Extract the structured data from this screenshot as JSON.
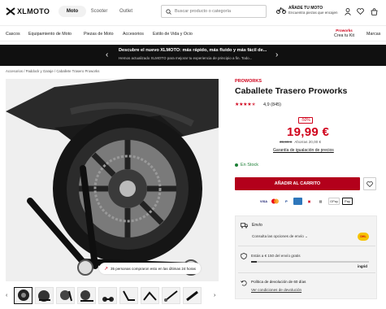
{
  "header": {
    "logo": "XLMOTO",
    "tabs": [
      "Moto",
      "Scooter",
      "Outlet"
    ],
    "search_placeholder": "Buscar producto o categoría",
    "moto": {
      "title": "AÑADE TU MOTO",
      "subtitle": "Encuentra piezas que encajen"
    }
  },
  "categories": [
    "Cascos",
    "Equipamiento de Moto",
    "Piezas de Moto",
    "Accesorios",
    "Estilo de Vida y Ocio",
    "Marcas"
  ],
  "kit": {
    "top": "Proworks",
    "label": "Crea tu Kit"
  },
  "banner": {
    "title": "Descubre el nuevo XLMOTO: más rápido, más fluido y más fácil de...",
    "text": "Hemos actualizado XLMOTO para mejorar tu experiencia de principio a fin. Todo..."
  },
  "breadcrumb": "Accesorios / Paddock y Garaje / Caballete Trasero Proworks",
  "gallery": {
    "social_proof": "35 personas compraron esto en las últimas 24 horas"
  },
  "product": {
    "brand": "PROWORKS",
    "title": "Caballete Trasero Proworks",
    "rating": "4,9 (845)",
    "stars": 4.9,
    "discount": "-50%",
    "price": "19,99 €",
    "old_price": "39,99 €",
    "savings": "Ahorras 20,00 €",
    "guarantee": "Garantía de igualación de precios",
    "stock": "En Stock",
    "add_to_cart": "AÑADIR AL CARRITO",
    "payments": [
      "VISA",
      "MC",
      "PayPal",
      "AMEX",
      "",
      "",
      "GPay",
      "Pay"
    ]
  },
  "shipping": {
    "title": "Envío",
    "options": "Consulta las opciones de envío",
    "free_text": "Estás a € 150 del envío gratis",
    "free_progress": 0.05,
    "partner": "ingrid",
    "carrier": "DHL",
    "returns_title": "Política de devolución de 60 días",
    "returns_link": "Ver condiciones de devolución"
  }
}
